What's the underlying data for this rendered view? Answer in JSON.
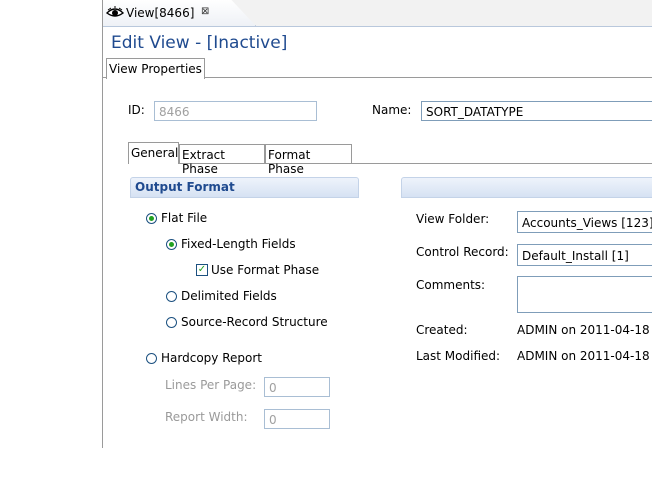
{
  "editor_tab": {
    "label": "View[8466]",
    "close_glyph": "⊠",
    "icon": "eye-icon"
  },
  "form": {
    "title": "Edit View - [Inactive]"
  },
  "subtab": {
    "label": "View Properties"
  },
  "id_field": {
    "label": "ID:",
    "value": "8466"
  },
  "name_field": {
    "label": "Name:",
    "value": "SORT_DATATYPE"
  },
  "general_tabs": [
    "General",
    "Extract Phase",
    "Format Phase"
  ],
  "output_format": {
    "title": "Output Format",
    "flat_file": "Flat File",
    "fixed_length": "Fixed-Length Fields",
    "use_format_phase": "Use Format Phase",
    "delimited": "Delimited Fields",
    "source_record": "Source-Record Structure",
    "hardcopy": "Hardcopy Report",
    "lines_per_page": {
      "label": "Lines Per Page:",
      "value": "0"
    },
    "report_width": {
      "label": "Report Width:",
      "value": "0"
    },
    "selected": "Flat File",
    "sub_selected": "Fixed-Length Fields",
    "use_format_phase_checked": true
  },
  "details": {
    "view_folder": {
      "label": "View Folder:",
      "value": "Accounts_Views [123]"
    },
    "control_record": {
      "label": "Control Record:",
      "value": "Default_Install [1]"
    },
    "comments": {
      "label": "Comments:",
      "value": ""
    },
    "created": {
      "label": "Created:",
      "value": "ADMIN on 2011-04-18"
    },
    "last_modified": {
      "label": "Last Modified:",
      "value": "ADMIN on 2011-04-18"
    }
  },
  "colors": {
    "title": "#1f4a8f",
    "radio_dot": "#21a121",
    "field_border": "#7f9db9"
  }
}
